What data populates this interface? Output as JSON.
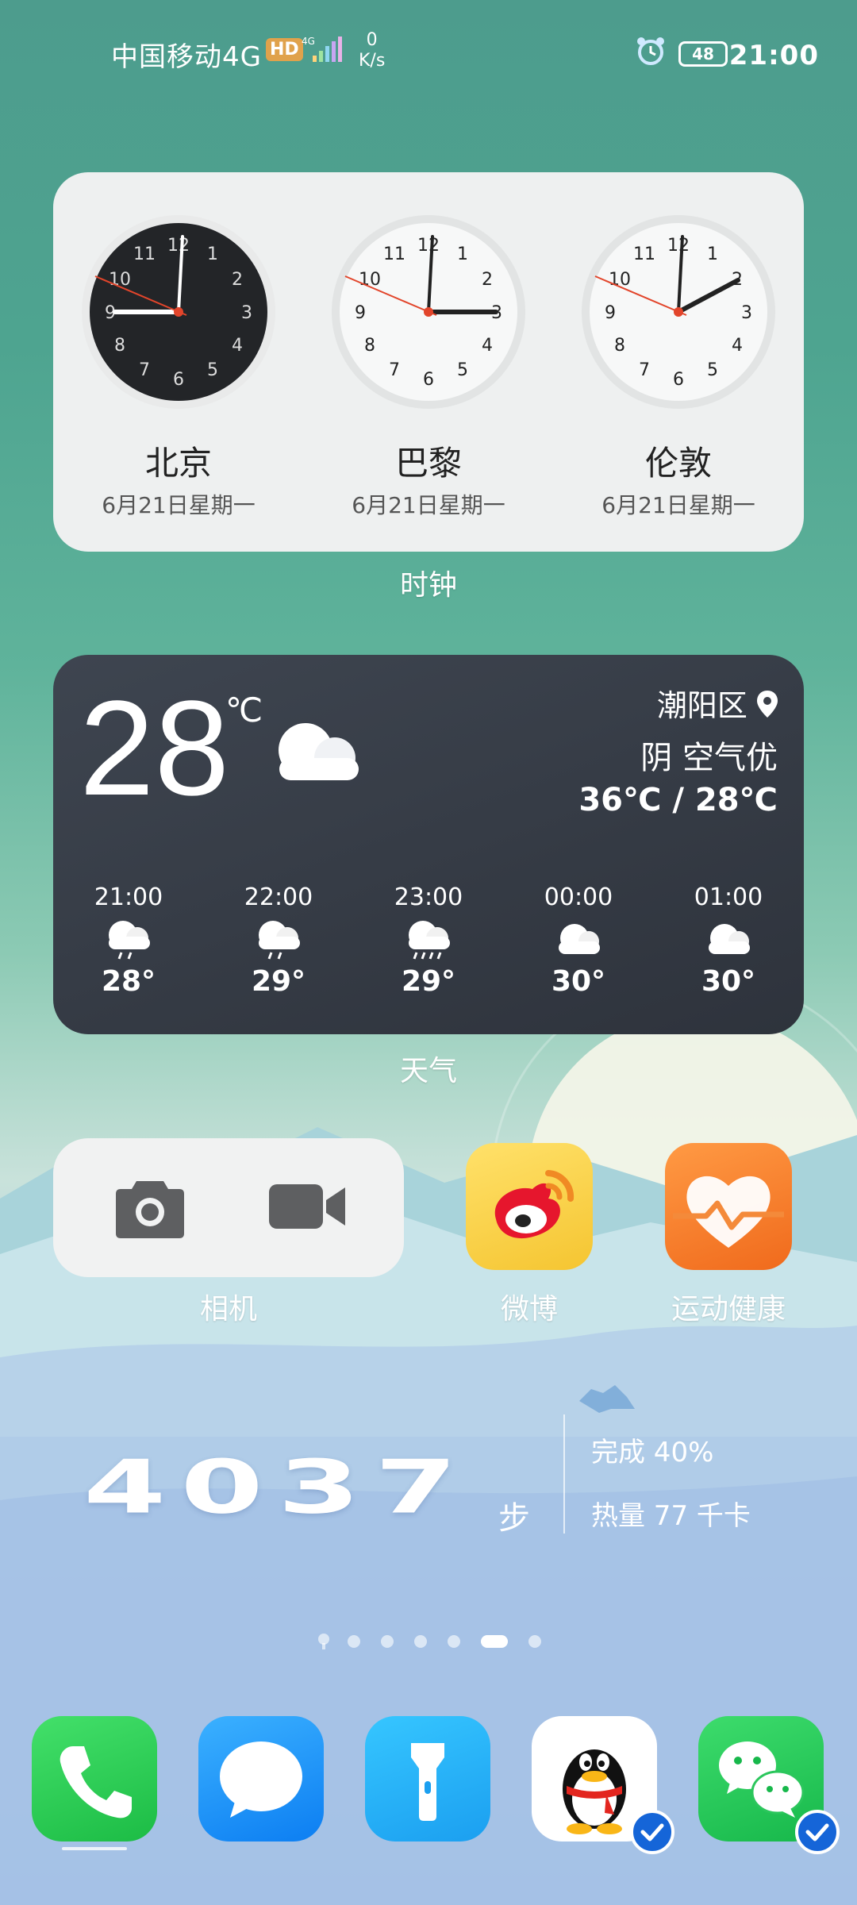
{
  "status_bar": {
    "carrier": "中国移动",
    "network": "4G",
    "hd_badge": "HD",
    "net_small": "4G",
    "speed_value": "0",
    "speed_unit": "K/s",
    "battery": "48",
    "time": "21:00"
  },
  "clock_widget": {
    "label": "时钟",
    "cities": [
      {
        "name": "北京",
        "date": "6月21日星期一"
      },
      {
        "name": "巴黎",
        "date": "6月21日星期一"
      },
      {
        "name": "伦敦",
        "date": "6月21日星期一"
      }
    ]
  },
  "weather_widget": {
    "label": "天气",
    "temperature": "28",
    "unit": "℃",
    "location": "潮阳区",
    "condition": "阴 空气优",
    "range": "36℃ / 28℃",
    "hourly": [
      {
        "time": "21:00",
        "temp": "28°",
        "icon": "rain-cloud-icon"
      },
      {
        "time": "22:00",
        "temp": "29°",
        "icon": "rain-cloud-icon"
      },
      {
        "time": "23:00",
        "temp": "29°",
        "icon": "heavy-rain-cloud-icon"
      },
      {
        "time": "00:00",
        "temp": "30°",
        "icon": "cloud-icon"
      },
      {
        "time": "01:00",
        "temp": "30°",
        "icon": "cloud-icon"
      }
    ]
  },
  "apps": {
    "camera": "相机",
    "weibo": "微博",
    "health": "运动健康"
  },
  "steps_widget": {
    "steps": "4037",
    "unit": "步",
    "completion": "完成 40%",
    "calories": "热量 77 千卡"
  },
  "dock": [
    "phone-app",
    "messages-app",
    "flashlight-app",
    "qq-app",
    "wechat-app"
  ],
  "page_indicator": {
    "pages": 7,
    "active": 6
  }
}
